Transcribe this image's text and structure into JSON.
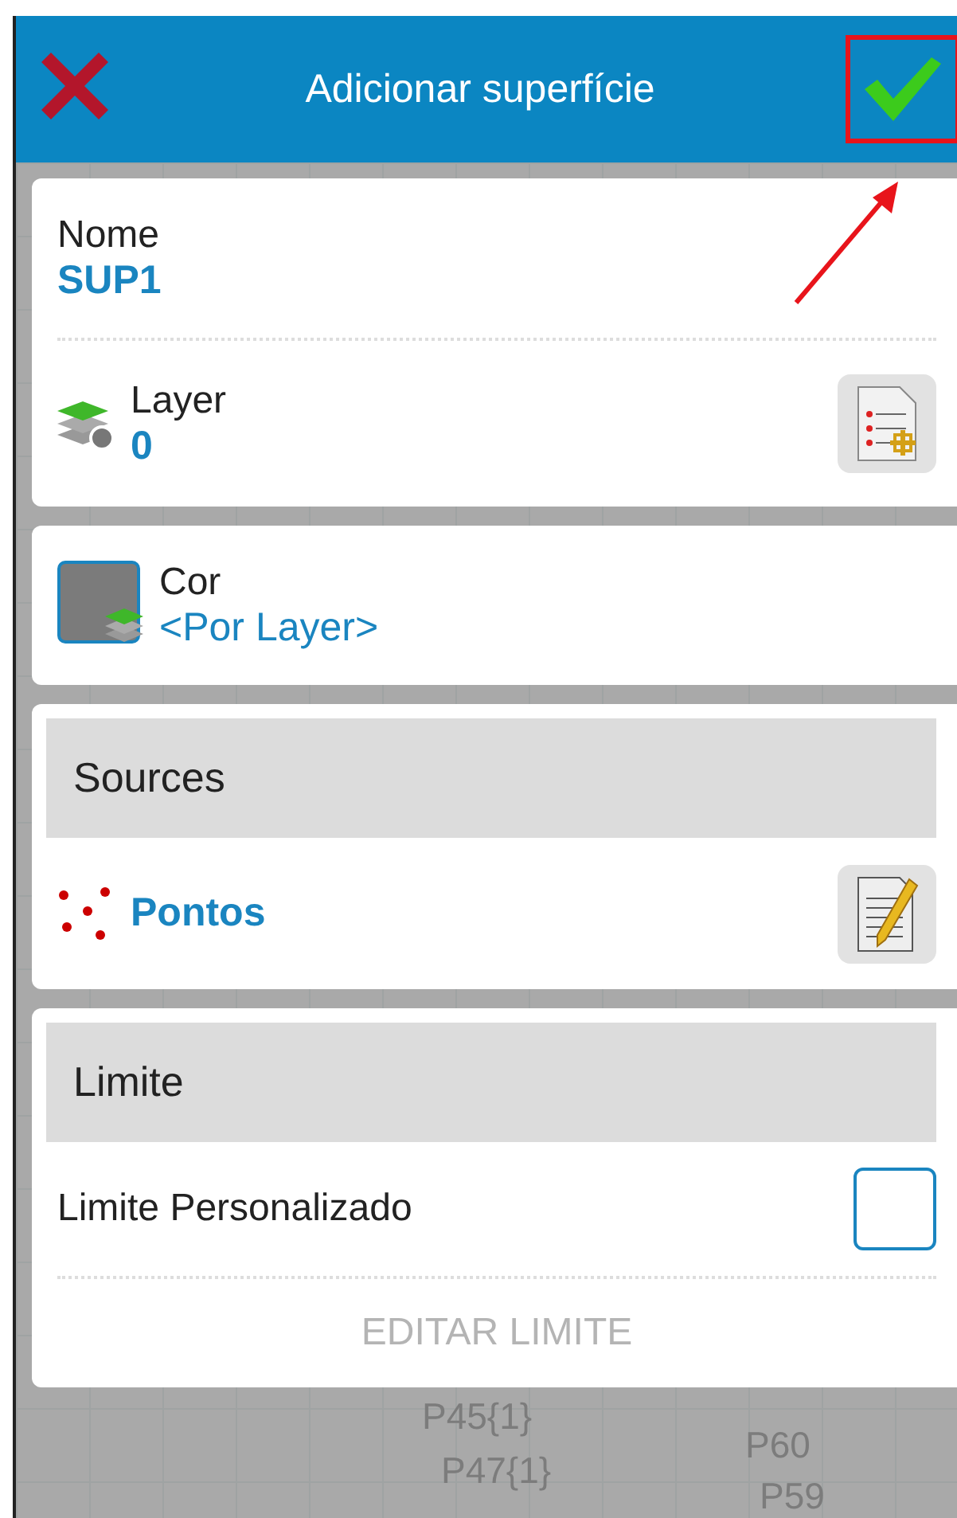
{
  "header": {
    "title": "Adicionar superfície"
  },
  "name_field": {
    "label": "Nome",
    "value": "SUP1"
  },
  "layer_field": {
    "label": "Layer",
    "value": "0"
  },
  "color_field": {
    "label": "Cor",
    "value": "<Por Layer>"
  },
  "sources": {
    "heading": "Sources",
    "items": [
      {
        "label": "Pontos"
      }
    ]
  },
  "limit": {
    "heading": "Limite",
    "custom": {
      "label": "Limite Personalizado",
      "checked": false
    },
    "edit_button": {
      "label": "EDITAR LIMITE",
      "disabled": true
    }
  },
  "canvas_labels": [
    {
      "label": "P45{1}"
    },
    {
      "label": "P60"
    },
    {
      "label": "P47{1}"
    },
    {
      "label": "P59"
    }
  ]
}
